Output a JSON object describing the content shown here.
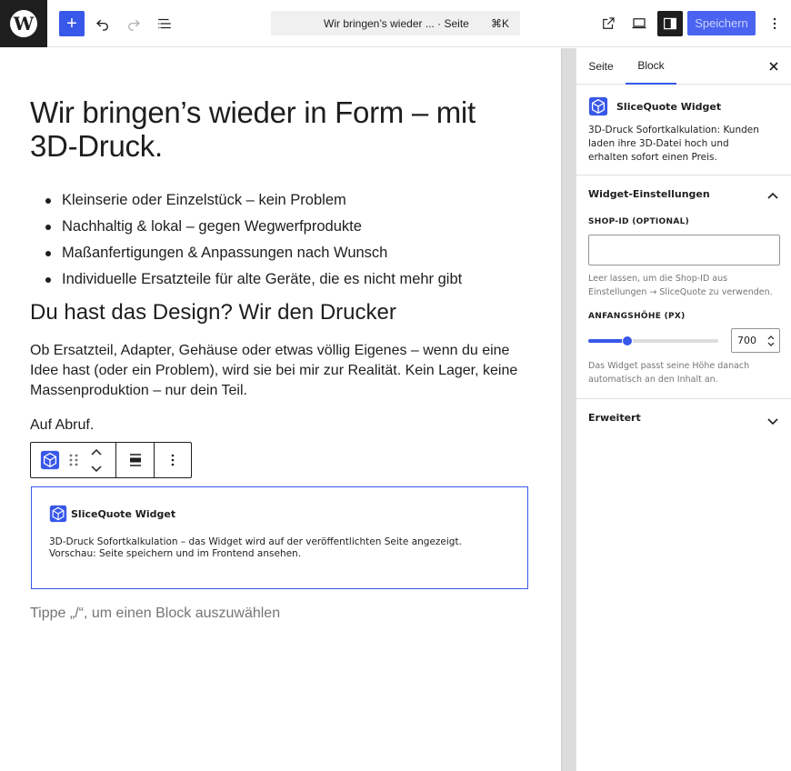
{
  "topbar": {
    "command_title": "Wir bringen’s wieder ... · Seite",
    "command_shortcut": "⌘K",
    "save_label": "Speichern"
  },
  "content": {
    "heading": "Wir bringen’s wieder in Form – mit 3D-Druck.",
    "bullets": [
      "Kleinserie oder Einzelstück – kein Problem",
      "Nachhaltig & lokal – gegen Wegwerfprodukte",
      "Maßanfertigungen & Anpassungen nach Wunsch",
      "Individuelle Ersatzteile für alte Geräte, die es nicht mehr gibt"
    ],
    "subheading": "Du hast das Design? Wir den Drucker",
    "paragraph": "Ob Ersatzteil, Adapter, Gehäuse oder etwas völlig Eigenes – wenn du eine Idee hast (oder ein Problem), wird sie bei mir zur Realität. Kein Lager, keine Massenproduktion – nur dein Teil.",
    "short_paragraph": "Auf Abruf.",
    "placeholder": "Tippe „/“, um einen Block auszuwählen"
  },
  "widget_block": {
    "title": "SliceQuote Widget",
    "line1": "3D-Druck Sofortkalkulation – das Widget wird auf der veröffentlichten Seite angezeigt.",
    "line2": "Vorschau: Seite speichern und im Frontend ansehen."
  },
  "sidebar": {
    "tab_page": "Seite",
    "tab_block": "Block",
    "block_title": "SliceQuote Widget",
    "block_description": "3D-Druck Sofortkalkulation: Kunden laden ihre 3D-Datei hoch und erhalten sofort einen Preis.",
    "panel_settings": "Widget-Einstellungen",
    "shop_id_label": "SHOP-ID (OPTIONAL)",
    "shop_id_value": "",
    "shop_id_help": "Leer lassen, um die Shop-ID aus Einstellungen → SliceQuote zu verwenden.",
    "height_label": "ANFANGSHÖHE (PX)",
    "height_value": "700",
    "height_slider_fraction": 0.3,
    "height_help": "Das Widget passt seine Höhe danach automatisch an den Inhalt an.",
    "panel_advanced": "Erweitert"
  },
  "colors": {
    "accent": "#3858e9",
    "dark": "#1e1e1e"
  }
}
